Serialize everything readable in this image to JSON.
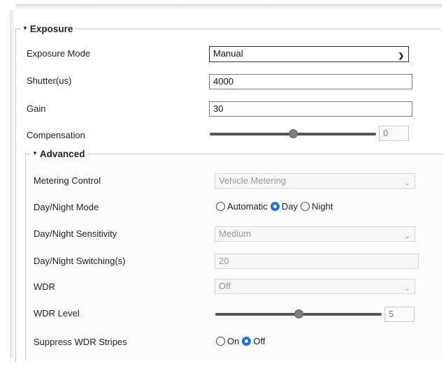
{
  "exposure": {
    "section_title": "Exposure",
    "mode": {
      "label": "Exposure Mode",
      "value": "Manual"
    },
    "shutter": {
      "label": "Shutter(us)",
      "value": "4000"
    },
    "gain": {
      "label": "Gain",
      "value": "30"
    },
    "compensation": {
      "label": "Compensation",
      "value": "0",
      "level_fraction": 0.5
    }
  },
  "advanced": {
    "section_title": "Advanced",
    "metering": {
      "label": "Metering Control",
      "value": "Vehicle Metering"
    },
    "day_night_mode": {
      "label": "Day/Night Mode",
      "options": [
        "Automatic",
        "Day",
        "Night"
      ],
      "selected": "Day"
    },
    "sensitivity": {
      "label": "Day/Night Sensitivity",
      "value": "Medium"
    },
    "switching": {
      "label": "Day/Night Switching(s)",
      "value": "20"
    },
    "wdr": {
      "label": "WDR",
      "value": "Off"
    },
    "wdr_level": {
      "label": "WDR Level",
      "value": "5",
      "level_fraction": 0.5
    },
    "suppress_stripes": {
      "label": "Suppress WDR Stripes",
      "options": [
        "On",
        "Off"
      ],
      "selected": "Off"
    }
  },
  "colors": {
    "radio_selected": "#1a73e8",
    "disabled_text": "#9a9a9a"
  }
}
